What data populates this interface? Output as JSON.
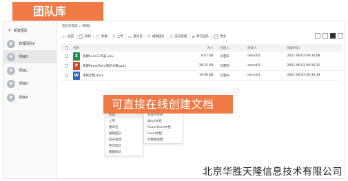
{
  "banner": {
    "title": "团队库"
  },
  "sidebar": {
    "new_team": "新建团队",
    "items": [
      {
        "label": "管理团队A",
        "active": false
      },
      {
        "label": "项目D",
        "active": true
      },
      {
        "label": "项目C",
        "active": false
      },
      {
        "label": "项目B",
        "active": false
      },
      {
        "label": "项目A",
        "active": false
      }
    ]
  },
  "breadcrumb": "团队内容库 > 项目D",
  "toolbar": {
    "back": "返回",
    "refresh": "刷新",
    "new": "新建",
    "upload": "上传",
    "rename": "重命名",
    "edit": "编辑团队",
    "member": "成员管理",
    "transfer": "移交团队",
    "more": "更多"
  },
  "table": {
    "headers": {
      "name": "名称",
      "size": "大小",
      "creator": "创建人",
      "modifier": "修改人",
      "time": "修改时间"
    },
    "rows": [
      {
        "icon_name": "excel-icon",
        "icon_letter": "X",
        "icon_color": "#1f8c4d",
        "name": "新建Excel工作表.xlsx",
        "size": "9.07 KB",
        "creator": "刘若阳",
        "modifier": "demo01",
        "time": "2021-06-03 09:34:08"
      },
      {
        "icon_name": "powerpoint-icon",
        "icon_letter": "P",
        "icon_color": "#d24625",
        "name": "新建PowerPoint演示文稿.pptx",
        "size": "28.55 KB",
        "creator": "刘若阳",
        "modifier": "demo01",
        "time": "2021-06-03 09:26:31"
      },
      {
        "icon_name": "word-icon",
        "icon_letter": "W",
        "icon_color": "#2b64c0",
        "name": "项目文档.docx",
        "size": "19.90 KB",
        "creator": "刘若阳",
        "modifier": "demo01",
        "time": "2021-06-03 09:36:39"
      }
    ]
  },
  "context_menu": {
    "items": [
      "新建",
      "上传",
      "重命名",
      "编辑团队",
      "成员管理",
      "移交团队",
      "解散团队"
    ]
  },
  "submenu": {
    "items": [
      "新建文件夹",
      "Word文档",
      "PowerPoint文档",
      "Excel文档",
      "云模板新建"
    ]
  },
  "callout": {
    "text": "可直接在线创建文档"
  },
  "footer": {
    "text": "北京华胜天隆信息技术有限公司"
  },
  "colors": {
    "accent": "#ef7a45"
  }
}
